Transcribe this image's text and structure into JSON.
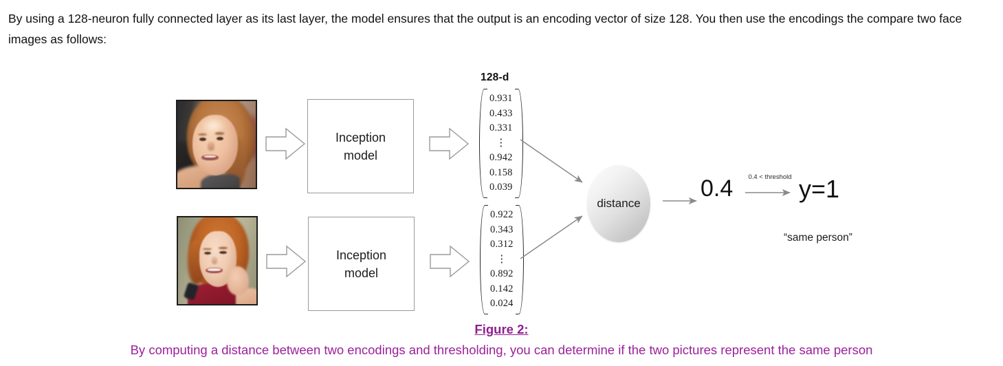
{
  "intro": {
    "paragraph": "By using a 128-neuron fully connected layer as its last layer, the model ensures that the output is an encoding vector of size 128. You then use the encodings the compare two face images as follows:"
  },
  "figure": {
    "dim_label": "128-d",
    "model_box_line1": "Inception",
    "model_box_line2": "model",
    "distance_label": "distance",
    "distance_score": "0.4",
    "threshold_label": "0.4 < threshold",
    "decision_output": "y=1",
    "decision_meaning": "“same person”",
    "vectors": [
      {
        "name": "encoding-vector-top",
        "values": [
          "0.931",
          "0.433",
          "0.331",
          "⋮",
          "0.942",
          "0.158",
          "0.039"
        ]
      },
      {
        "name": "encoding-vector-bottom",
        "values": [
          "0.922",
          "0.343",
          "0.312",
          "⋮",
          "0.892",
          "0.142",
          "0.024"
        ]
      }
    ],
    "photos": [
      {
        "alt": "face-photo-top"
      },
      {
        "alt": "face-photo-bottom"
      }
    ]
  },
  "caption": {
    "title": "Figure 2",
    "title_suffix": ":",
    "text": "By computing a distance between two encodings and thresholding, you can determine if the two pictures represent the same person"
  },
  "colors": {
    "caption_purple": "#9b219b",
    "box_border": "#9a9a9a",
    "arrow_gray": "#8a8a8a",
    "text_black": "#111111"
  }
}
